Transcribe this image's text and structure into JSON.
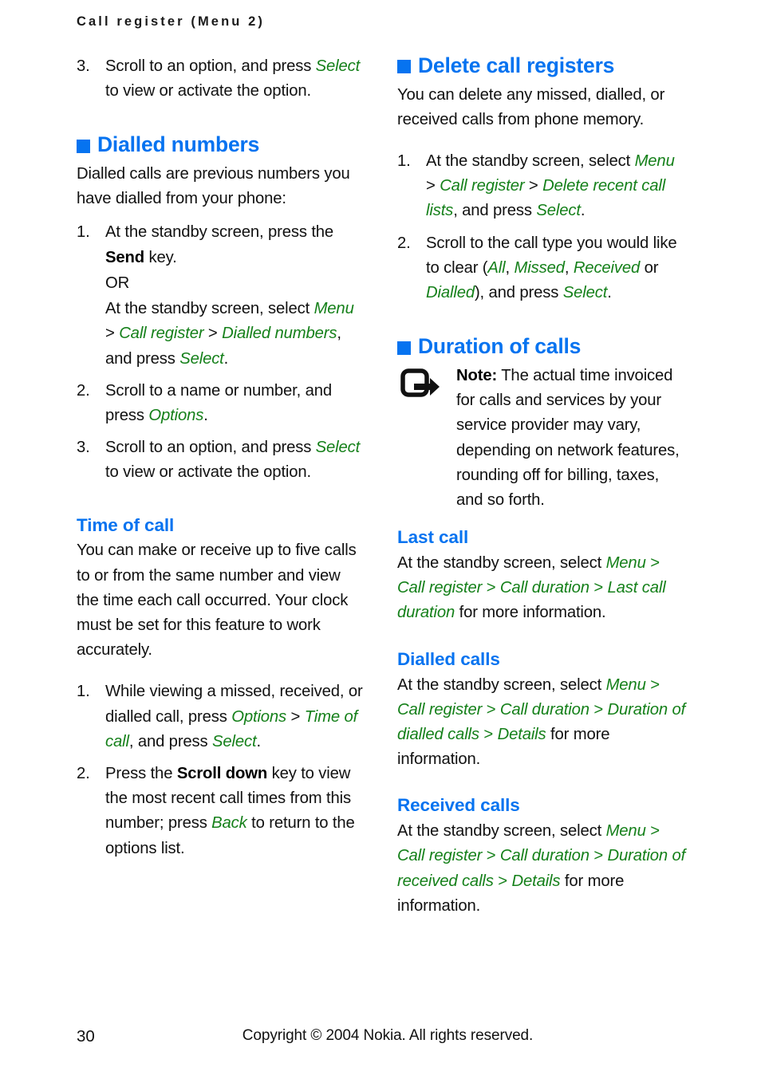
{
  "document": {
    "running_header": "Call register (Menu 2)",
    "page_number": "30",
    "copyright": "Copyright © 2004 Nokia. All rights reserved.",
    "accent_blue": "#0673f0",
    "accent_green": "#15801a"
  },
  "left_column": {
    "step3_top": {
      "num": "3.",
      "t1": "Scroll to an option, and press ",
      "ui1": "Select",
      "t2": " to view or activate the option."
    },
    "dialled_numbers": {
      "heading": "Dialled numbers",
      "intro": "Dialled calls are previous numbers you have dialled from your phone:",
      "step1": {
        "num": "1.",
        "t1": "At the standby screen, press the ",
        "kb1": "Send",
        "t2": " key.",
        "or": "OR",
        "alt_t1": "At the standby screen, select ",
        "alt_ui1": "Menu",
        "alt_sep1": " > ",
        "alt_ui2": "Call register",
        "alt_sep2": " > ",
        "alt_ui3": "Dialled numbers",
        "alt_t2": ", and press ",
        "alt_ui4": "Select",
        "alt_t3": "."
      },
      "step2": {
        "num": "2.",
        "t1": "Scroll to a name or number, and press ",
        "ui1": "Options",
        "t2": "."
      },
      "step3": {
        "num": "3.",
        "t1": "Scroll to an option, and press ",
        "ui1": "Select",
        "t2": " to view or activate the option."
      }
    },
    "time_of_call": {
      "heading": "Time of call",
      "intro": "You can make or receive up to five calls to or from the same number and view the time each call occurred. Your clock must be set for this feature to work accurately.",
      "step1": {
        "num": "1.",
        "t1": "While viewing a missed, received, or dialled call, press ",
        "ui1": "Options",
        "sep1": " > ",
        "ui2": "Time of call",
        "t2": ", and press ",
        "ui3": "Select",
        "t3": "."
      },
      "step2": {
        "num": "2.",
        "t1": "Press the ",
        "kb1": "Scroll down",
        "t2": " key to view the most recent call times from this number; press ",
        "ui1": "Back",
        "t3": " to return to the options list."
      }
    }
  },
  "right_column": {
    "delete_call_registers": {
      "heading": "Delete call registers",
      "intro": "You can delete any missed, dialled, or received calls from phone memory.",
      "step1": {
        "num": "1.",
        "t1": "At the standby screen, select ",
        "ui1": "Menu",
        "sep1": " > ",
        "ui2": "Call register",
        "sep2": " > ",
        "ui3": "Delete recent call lists",
        "t2": ", and press ",
        "ui4": "Select",
        "t3": "."
      },
      "step2": {
        "num": "2.",
        "t1": "Scroll to the call type you would like to clear (",
        "ui1": "All",
        "t2": ", ",
        "ui2": "Missed",
        "t3": ", ",
        "ui3": "Received",
        "t4": " or ",
        "ui4": "Dialled",
        "t5": "), and press ",
        "ui5": "Select",
        "t6": "."
      }
    },
    "duration_of_calls": {
      "heading": "Duration of calls",
      "note": {
        "icon": "note-pointer-icon",
        "label": "Note:",
        "text": " The actual time invoiced for calls and services by your service provider may vary, depending on network features, rounding off for billing, taxes, and so forth."
      },
      "last_call": {
        "heading": "Last call",
        "t1": "At the standby screen, select ",
        "ui1": "Menu",
        "sep1": " > ",
        "ui2": "Call register",
        "sep2": " > ",
        "ui3": "Call duration",
        "sep3": " > ",
        "ui4": "Last call duration",
        "t2": " for more information."
      },
      "dialled_calls": {
        "heading": "Dialled calls",
        "t1": "At the standby screen, select ",
        "ui1": "Menu",
        "sep1": " > ",
        "ui2": "Call register",
        "sep2": " > ",
        "ui3": "Call duration",
        "sep3": " > ",
        "ui4": "Duration of dialled calls",
        "sep4": " > ",
        "ui5": "Details",
        "t2": " for more information."
      },
      "received_calls": {
        "heading": "Received calls",
        "t1": "At the standby screen, select ",
        "ui1": "Menu",
        "sep1": " > ",
        "ui2": "Call register",
        "sep2": " > ",
        "ui3": "Call duration",
        "sep3": " > ",
        "ui4": "Duration of received calls",
        "sep4": " > ",
        "ui5": "Details",
        "t2": " for more information."
      }
    }
  }
}
